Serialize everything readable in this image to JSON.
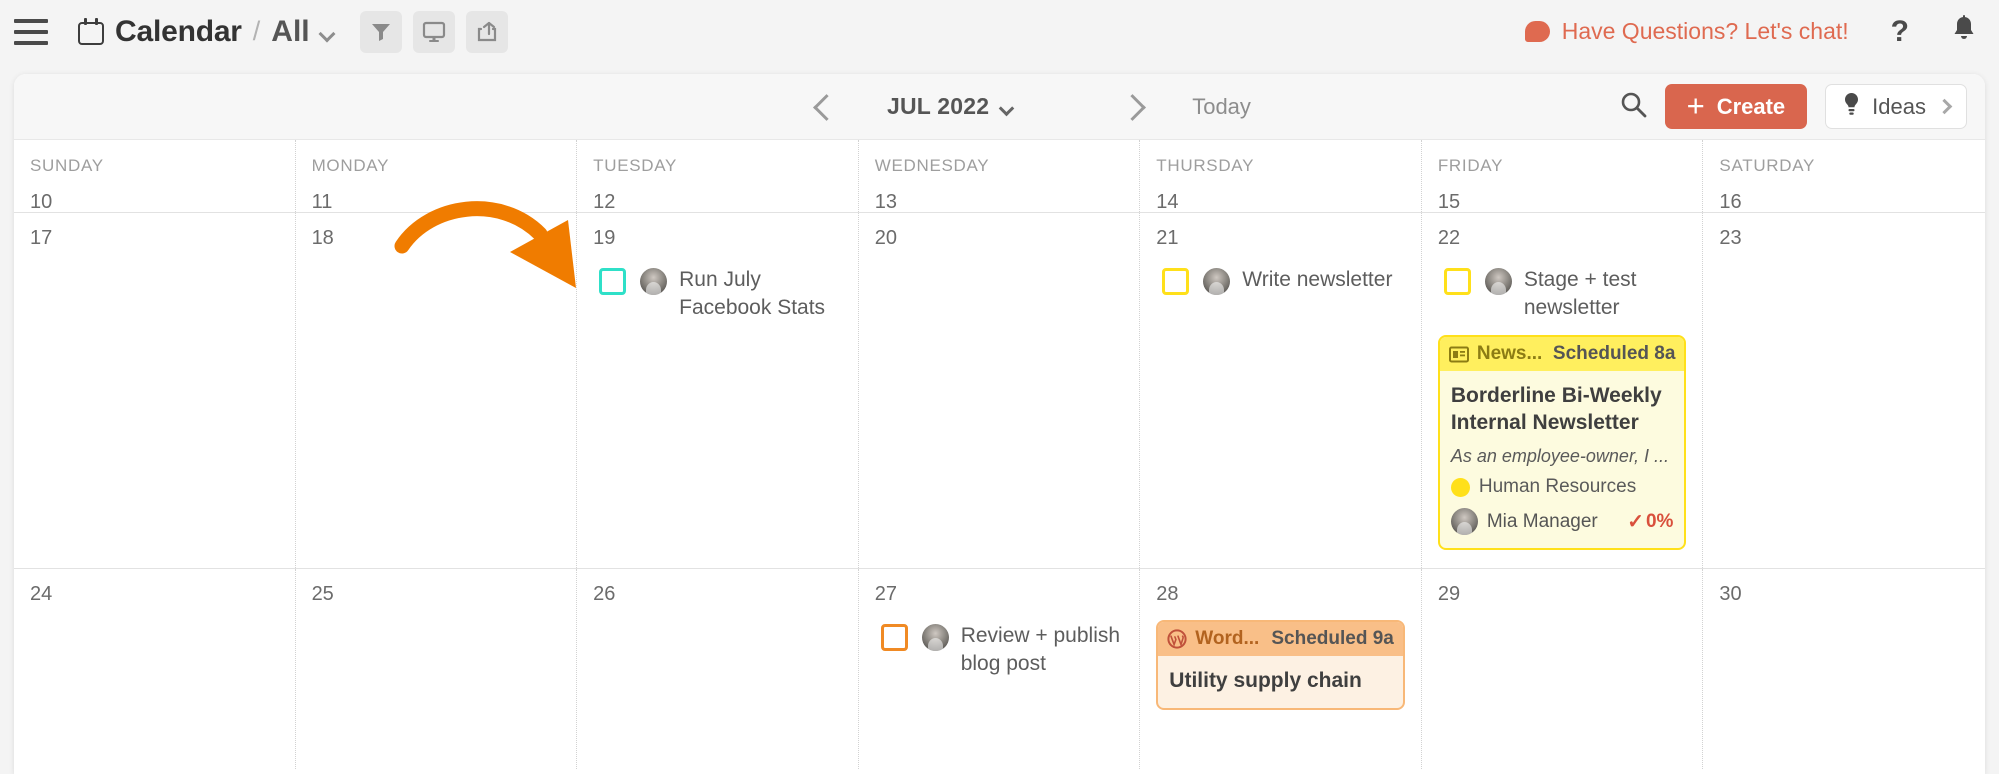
{
  "appbar": {
    "menu_icon": "hamburger-icon",
    "calendar_icon": "calendar-icon",
    "title": "Calendar",
    "separator": "/",
    "view": "All",
    "tools": [
      {
        "name": "filter-icon",
        "label": "Filter"
      },
      {
        "name": "display-icon",
        "label": "Display"
      },
      {
        "name": "share-icon",
        "label": "Share"
      }
    ],
    "chat_label": "Have Questions? Let's chat!",
    "help_label": "?",
    "notifications_icon": "bell-icon",
    "accent_color": "#df6a50"
  },
  "toolbar": {
    "prev_label": "Previous",
    "month": "JUL 2022",
    "next_label": "Next",
    "today_label": "Today",
    "search_label": "Search",
    "create_label": "Create",
    "create_plus": "+",
    "ideas_label": "Ideas",
    "create_color": "#d9664e"
  },
  "calendar": {
    "daynames": [
      "SUNDAY",
      "MONDAY",
      "TUESDAY",
      "WEDNESDAY",
      "THURSDAY",
      "FRIDAY",
      "SATURDAY"
    ],
    "week1": [
      "10",
      "11",
      "12",
      "13",
      "14",
      "15",
      "16"
    ],
    "week2": [
      "17",
      "18",
      "19",
      "20",
      "21",
      "22",
      "23"
    ],
    "week3": [
      "24",
      "25",
      "26",
      "27",
      "28",
      "29",
      "30"
    ],
    "tasks": {
      "tue19": {
        "text": "Run July Facebook Stats",
        "checkbox_color": "#2fe0c8"
      },
      "thu21": {
        "text": "Write newsletter",
        "checkbox_color": "#ffe01a"
      },
      "fri22": {
        "text": "Stage + test newsletter",
        "checkbox_color": "#ffe01a"
      },
      "wed27": {
        "text": "Review + publish blog post",
        "checkbox_color": "#f08a24"
      }
    },
    "cards": {
      "fri22": {
        "channel_icon": "newsletter-icon",
        "channel": "News...",
        "status": "Scheduled 8a",
        "title": "Borderline Bi-Weekly Internal Newsletter",
        "description": "As an employee-owner, I ...",
        "tag": "Human Resources",
        "tag_color": "#ffe01a",
        "owner": "Mia Manager",
        "progress": "0%",
        "progress_color": "#d9503c"
      },
      "thu28": {
        "channel_icon": "wordpress-icon",
        "channel": "Word...",
        "status": "Scheduled 9a",
        "title": "Utility supply chain"
      }
    }
  },
  "annotation": {
    "arrow_color": "#f07c00",
    "name": "curved-arrow-pointing-to-tuesday-19"
  }
}
